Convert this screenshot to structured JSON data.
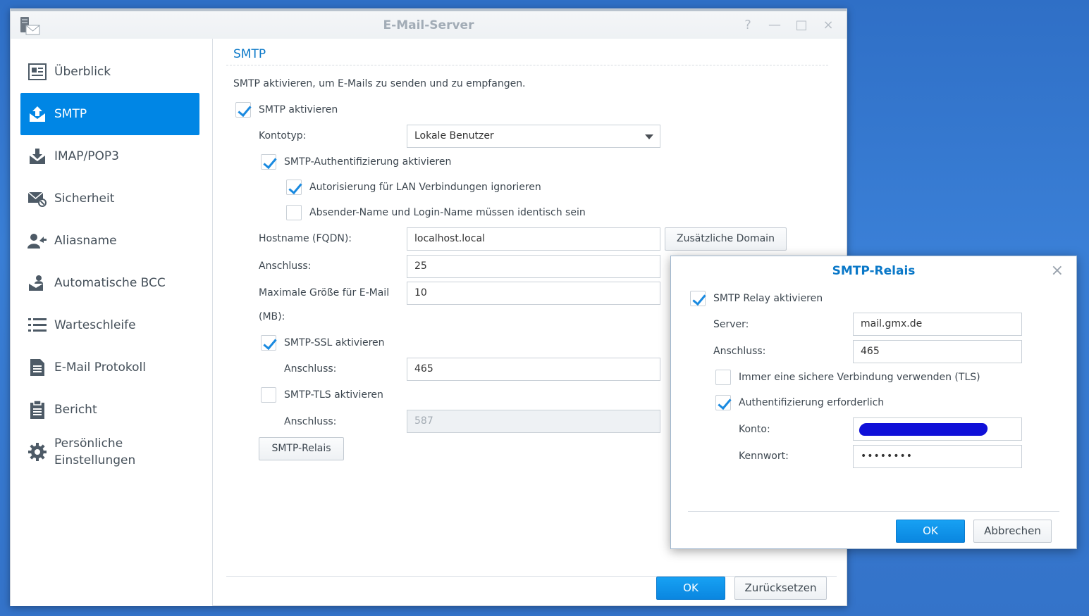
{
  "window": {
    "title": "E-Mail-Server",
    "controls": {
      "help": "?",
      "minimize": "—",
      "maximize": "□",
      "close": "×"
    }
  },
  "sidebar": {
    "items": [
      {
        "label": "Überblick",
        "icon": "overview-icon"
      },
      {
        "label": "SMTP",
        "icon": "smtp-upload-icon",
        "active": true
      },
      {
        "label": "IMAP/POP3",
        "icon": "imap-download-icon"
      },
      {
        "label": "Sicherheit",
        "icon": "mail-security-icon"
      },
      {
        "label": "Aliasname",
        "icon": "alias-user-icon"
      },
      {
        "label": "Automatische BCC",
        "icon": "bcc-icon"
      },
      {
        "label": "Warteschleife",
        "icon": "list-icon"
      },
      {
        "label": "E-Mail Protokoll",
        "icon": "log-document-icon"
      },
      {
        "label": "Bericht",
        "icon": "clipboard-report-icon"
      },
      {
        "label_line1": "Persönliche",
        "label_line2": "Einstellungen",
        "icon": "gear-icon"
      }
    ]
  },
  "smtp": {
    "section_title": "SMTP",
    "description": "SMTP aktivieren, um E-Mails zu senden und zu empfangen.",
    "enable_label": "SMTP aktivieren",
    "account_type_label": "Kontotyp:",
    "account_type_value": "Lokale Benutzer",
    "auth_label": "SMTP-Authentifizierung aktivieren",
    "lan_ignore_label": "Autorisierung für LAN Verbindungen ignorieren",
    "sender_login_label": "Absender-Name und Login-Name müssen identisch sein",
    "hostname_label": "Hostname (FQDN):",
    "hostname_value": "localhost.local",
    "extra_domain_button": "Zusätzliche Domain",
    "port_label": "Anschluss:",
    "port_value": "25",
    "max_size_label_1": "Maximale Größe für E-Mail",
    "max_size_label_2": "(MB):",
    "max_size_value": "10",
    "ssl_label": "SMTP-SSL aktivieren",
    "ssl_port_label": "Anschluss:",
    "ssl_port_value": "465",
    "tls_label": "SMTP-TLS aktivieren",
    "tls_port_label": "Anschluss:",
    "tls_port_value": "587",
    "relay_button": "SMTP-Relais",
    "ok_button": "OK",
    "reset_button": "Zurücksetzen"
  },
  "relay_dialog": {
    "title": "SMTP-Relais",
    "enable_label": "SMTP Relay aktivieren",
    "server_label": "Server:",
    "server_value": "mail.gmx.de",
    "port_label": "Anschluss:",
    "port_value": "465",
    "tls_label": "Immer eine sichere Verbindung verwenden (TLS)",
    "auth_label": "Authentifizierung erforderlich",
    "account_label": "Konto:",
    "password_label": "Kennwort:",
    "password_value": "••••••••",
    "ok_button": "OK",
    "cancel_button": "Abbrechen",
    "close": "×"
  }
}
